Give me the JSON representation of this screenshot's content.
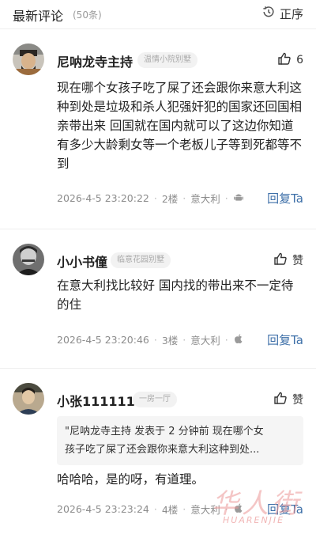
{
  "header": {
    "title": "最新评论",
    "count": "(50条)",
    "sort_label": "正序",
    "sort_icon": "clock-icon"
  },
  "comments": [
    {
      "username": "尼呐龙寺主持",
      "badge": "温情小院别墅",
      "like_icon": "thumbs-up-icon",
      "like_count": "6",
      "body": "现在哪个女孩子吃了屎了还会跟你来意大利这种到处是垃圾和杀人犯强奸犯的国家还回国相亲带出来 回国就在国内就可以了这边你知道有多少大龄剩女等一个老板儿子等到死都等不到",
      "timestamp": "2026-4-5 23:20:22",
      "floor": "2楼",
      "location": "意大利",
      "device_icon": "android-icon",
      "reply_label": "回复Ta"
    },
    {
      "username": "小小书僮",
      "badge": "临意花园别墅",
      "like_icon": "thumbs-up-icon",
      "like_count": "赞",
      "body": "在意大利找比较好 国内找的带出来不一定待的住",
      "timestamp": "2026-4-5 23:20:46",
      "floor": "3楼",
      "location": "意大利",
      "device_icon": "apple-icon",
      "reply_label": "回复Ta"
    },
    {
      "username": "小张111111",
      "badge": "一房一厅",
      "like_icon": "thumbs-up-icon",
      "like_count": "赞",
      "quote_line1": "\"尼呐龙寺主持 发表于 2 分钟前 现在哪个女",
      "quote_line2": "孩子吃了屎了还会跟你来意大利这种到处...",
      "body": "哈哈哈，是的呀，有道理。",
      "timestamp": "2026-4-5 23:23:24",
      "floor": "4楼",
      "location": "意大利",
      "device_icon": "apple-icon",
      "reply_label": "回复Ta"
    }
  ],
  "watermark": {
    "brand": "华人街",
    "sub": "HUARENJIE"
  },
  "colors": {
    "reply_blue": "#3d6fa8",
    "meta_grey": "#8c8c8c",
    "badge_bg": "#f2f2f2",
    "watermark": "#eb9696"
  }
}
